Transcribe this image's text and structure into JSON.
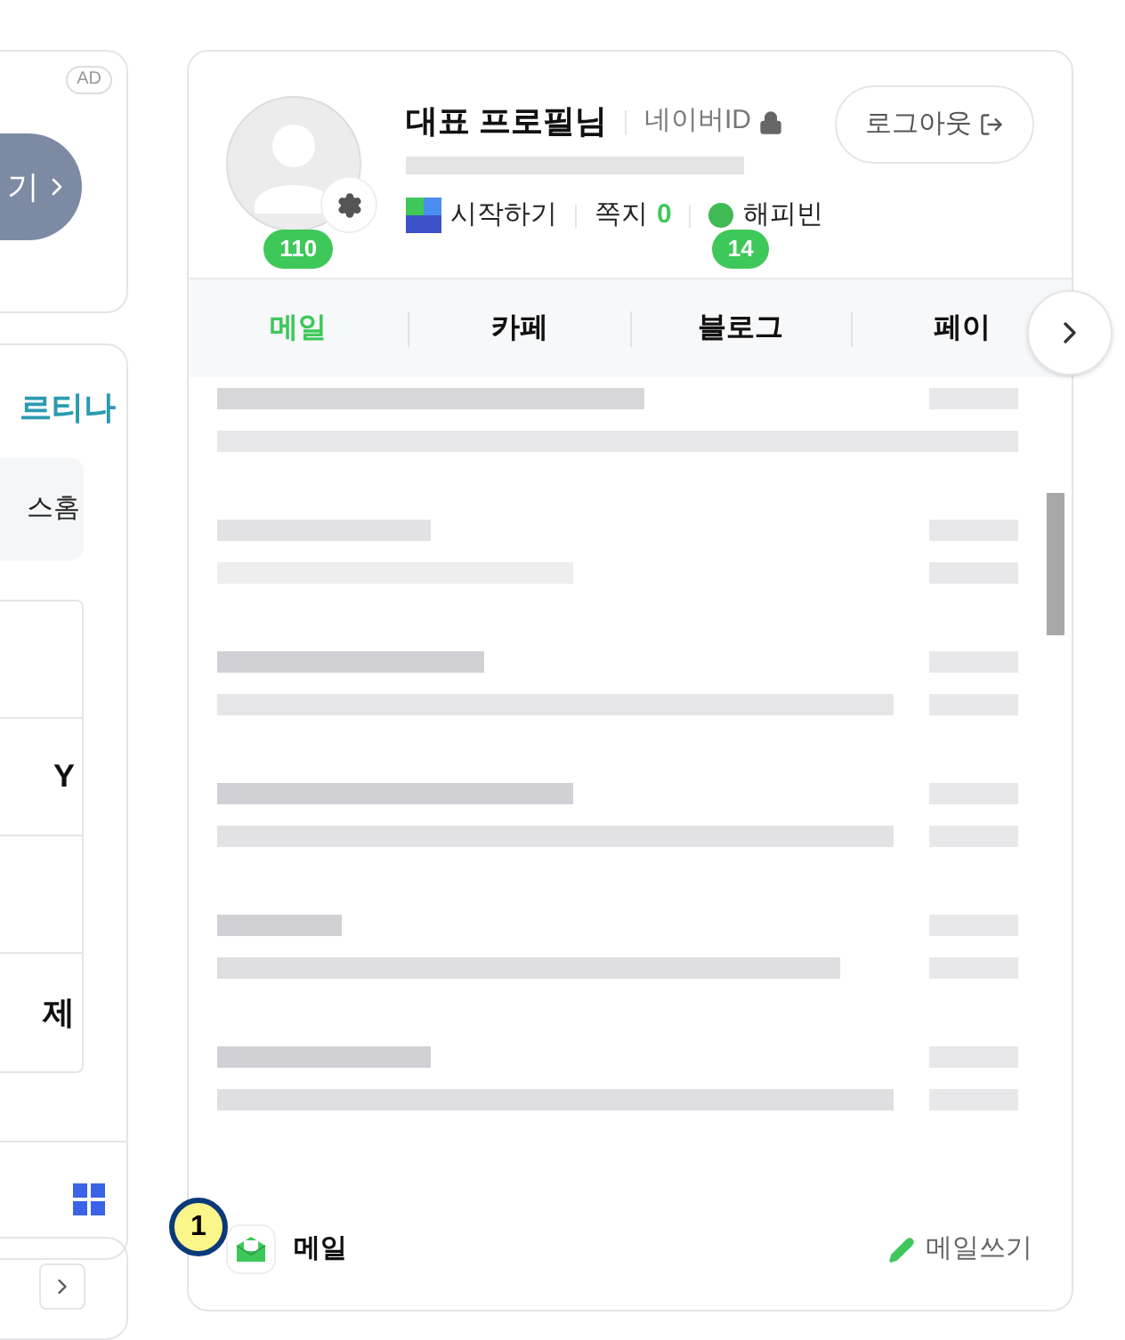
{
  "ad_panel": {
    "badge": "AD",
    "button": "기"
  },
  "left_panel": {
    "title": "르티나",
    "chip": "스홈",
    "rows": [
      "Y",
      "제"
    ]
  },
  "profile": {
    "name": "대표 프로필님",
    "id_label": "네이버ID",
    "logout": "로그아웃",
    "links": [
      {
        "kind": "nplus",
        "label": "시작하기"
      },
      {
        "kind": "note",
        "label": "쪽지",
        "count": "0"
      },
      {
        "kind": "happybean",
        "label": "해피빈"
      }
    ]
  },
  "tabs": [
    {
      "label": "메일",
      "badge": "110",
      "selected": true
    },
    {
      "label": "카페",
      "selected": false
    },
    {
      "label": "블로그",
      "badge": "14",
      "selected": false
    },
    {
      "label": "페이",
      "selected": false
    }
  ],
  "footer": {
    "service": "메일",
    "action": "메일쓰기"
  },
  "marker": {
    "label": "1"
  }
}
